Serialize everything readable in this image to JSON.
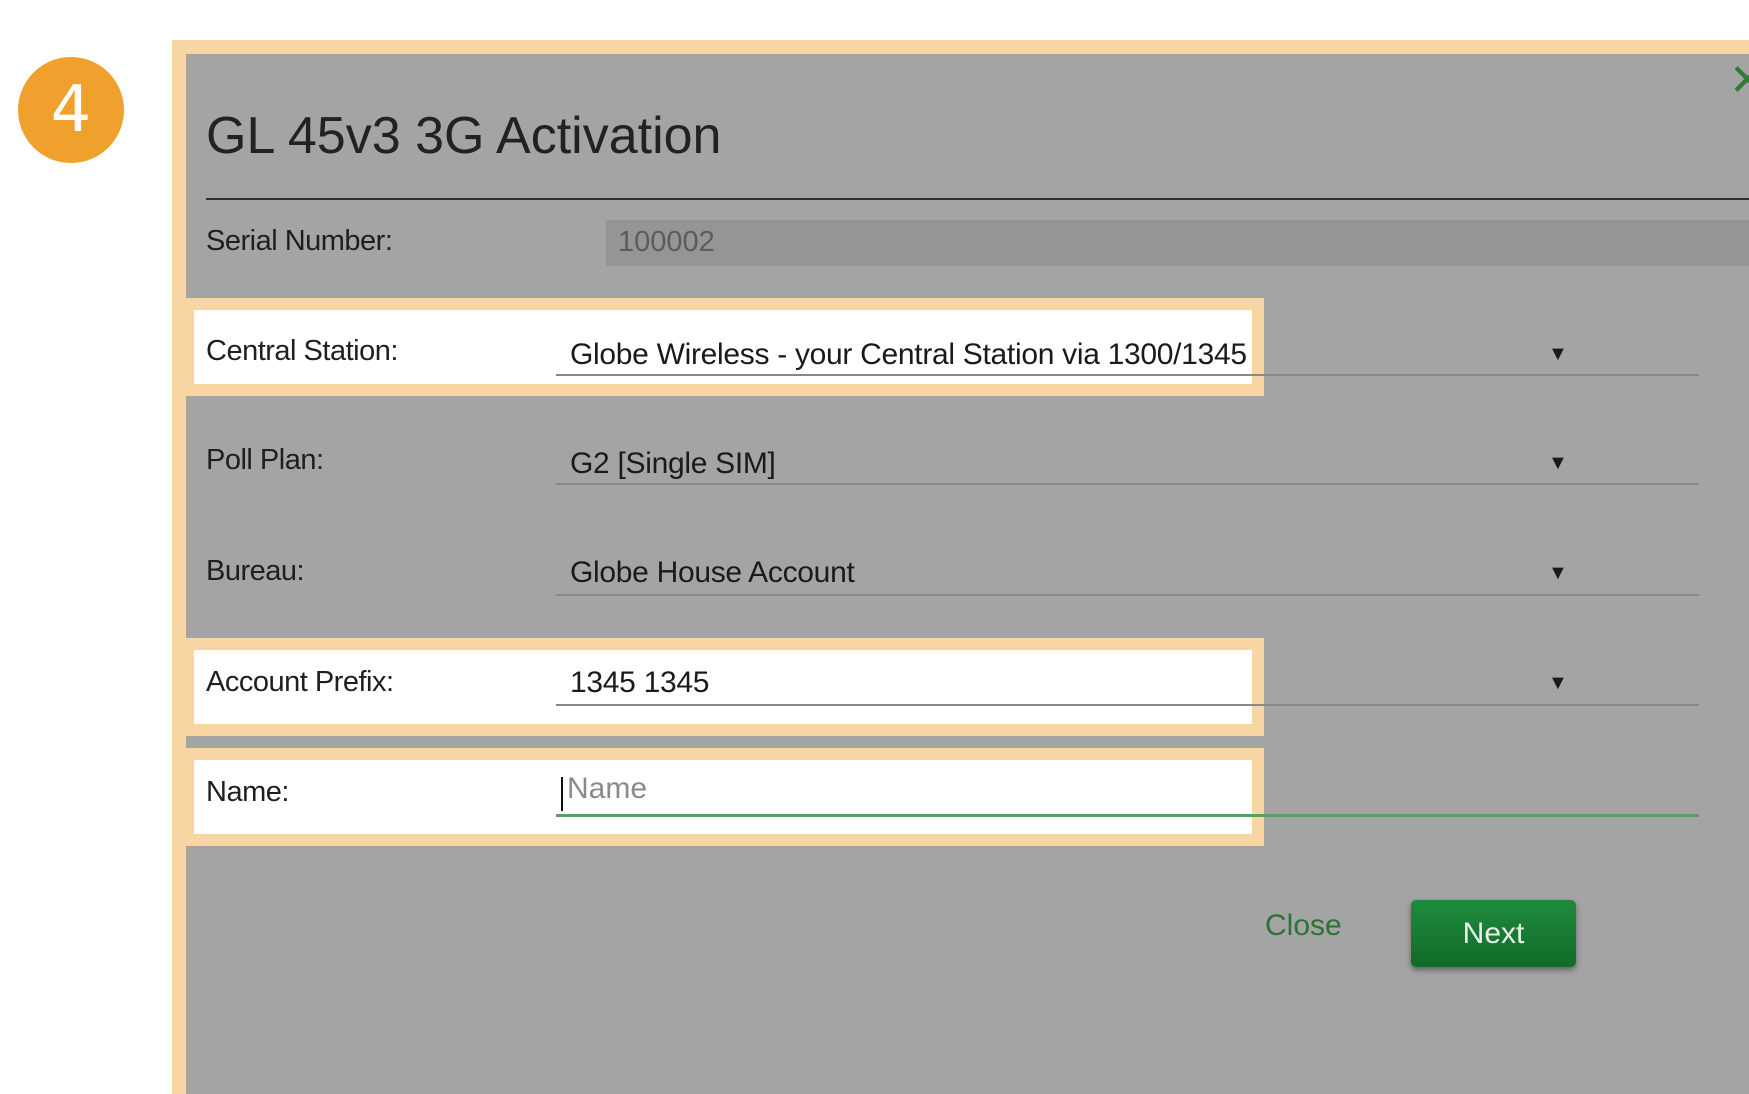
{
  "step_number": "4",
  "dialog": {
    "title": "GL 45v3 3G Activation",
    "close_icon": "close-icon"
  },
  "fields": {
    "serial_number": {
      "label": "Serial Number:",
      "value": "100002"
    },
    "central_station": {
      "label": "Central Station:",
      "value": "Globe Wireless - your Central Station via 1300/1345"
    },
    "poll_plan": {
      "label": "Poll Plan:",
      "value": "G2 [Single SIM]"
    },
    "bureau": {
      "label": "Bureau:",
      "value": "Globe House Account"
    },
    "account_prefix": {
      "label": "Account Prefix:",
      "value": "1345 1345"
    },
    "name": {
      "label": "Name:",
      "value": "",
      "placeholder": "Name"
    }
  },
  "buttons": {
    "close_label": "Close",
    "next_label": "Next"
  },
  "colors": {
    "highlight": "#f8d6a4",
    "step_badge": "#f0a12d",
    "accent_green": "#1f8b3c"
  }
}
